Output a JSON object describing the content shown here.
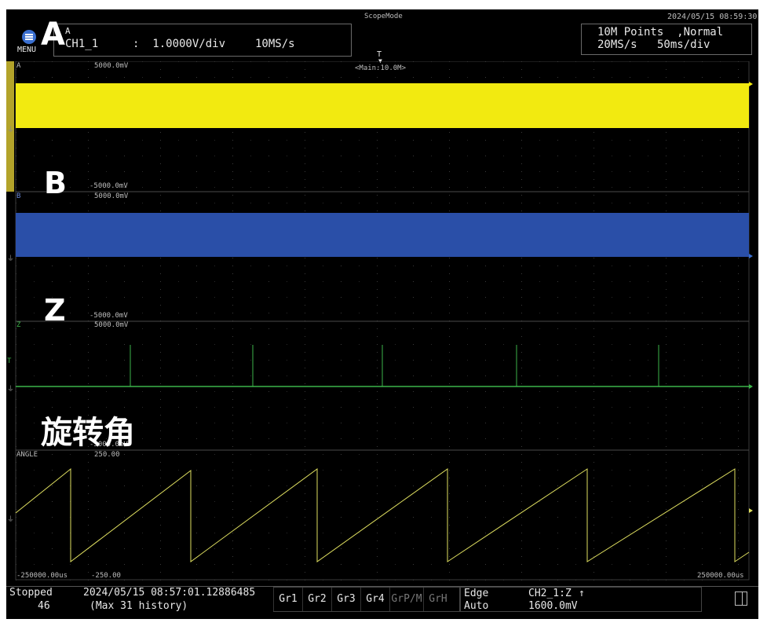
{
  "header": {
    "mode_title": "ScopeMode",
    "datetime": "2024/05/15 08:59:30",
    "menu_label": "MENU",
    "channel_group": "A",
    "channel_name": "CH1_1",
    "scale": ":  1.0000V/div",
    "sample_rate": "10MS/s",
    "record_points": "10M Points  ,Normal",
    "acq_rate": "20MS/s",
    "time_div": "50ms/div",
    "trigger_marker": "T",
    "zoom_label": "<Main:10.0M>"
  },
  "channels": [
    {
      "id": "A",
      "label": "A",
      "top": "5000.0mV",
      "bottom": "-5000.0mV",
      "color": "#f2ea10"
    },
    {
      "id": "B",
      "label": "B",
      "top": "5000.0mV",
      "bottom": "-5000.0mV",
      "color": "#2a4fa8"
    },
    {
      "id": "Z",
      "label": "Z",
      "top": "5000.0mV",
      "bottom": "-5000.0mV",
      "color": "#3cb44a"
    },
    {
      "id": "ANGLE",
      "label": "ANGLE",
      "top": "250.00",
      "bottom": "-250.00",
      "color": "#e0e060"
    }
  ],
  "axis": {
    "start": "-250000.00us",
    "end": "250000.00us"
  },
  "overlay_labels": {
    "a": "A",
    "b": "B",
    "z": "Z",
    "angle": "旋转角"
  },
  "status": {
    "state": "Stopped",
    "count": "46",
    "timestamp": "2024/05/15 08:57:01.12886485",
    "history": "(Max 31 history)"
  },
  "groups": [
    {
      "label": "Gr1",
      "active": true
    },
    {
      "label": "Gr2",
      "active": true
    },
    {
      "label": "Gr3",
      "active": true
    },
    {
      "label": "Gr4",
      "active": true
    },
    {
      "label": "GrP/M",
      "active": false
    },
    {
      "label": "GrH",
      "active": false
    }
  ],
  "trigger": {
    "type": "Edge",
    "mode": "Auto",
    "source": "CH2_1:Z",
    "level": "1600.0mV"
  }
}
